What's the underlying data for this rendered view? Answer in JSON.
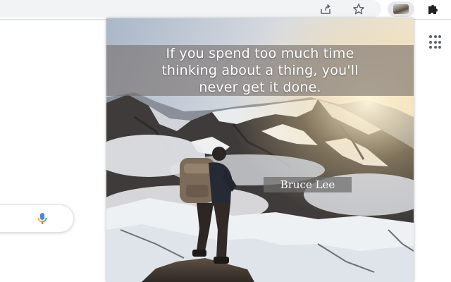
{
  "toolbar": {
    "icons": [
      "share-icon",
      "star-icon",
      "extension-thumbnail",
      "puzzle-icon"
    ]
  },
  "page": {
    "icons": [
      "apps-grid-icon",
      "microphone-icon"
    ]
  },
  "popup": {
    "quote_lines": [
      "If you spend too much time",
      "thinking about a thing, you'll",
      "never get it done."
    ],
    "author": "Bruce Lee"
  },
  "colors": {
    "mic_blue": "#4285f4",
    "mic_red": "#ea4335",
    "icon_gray": "#5f6368"
  }
}
